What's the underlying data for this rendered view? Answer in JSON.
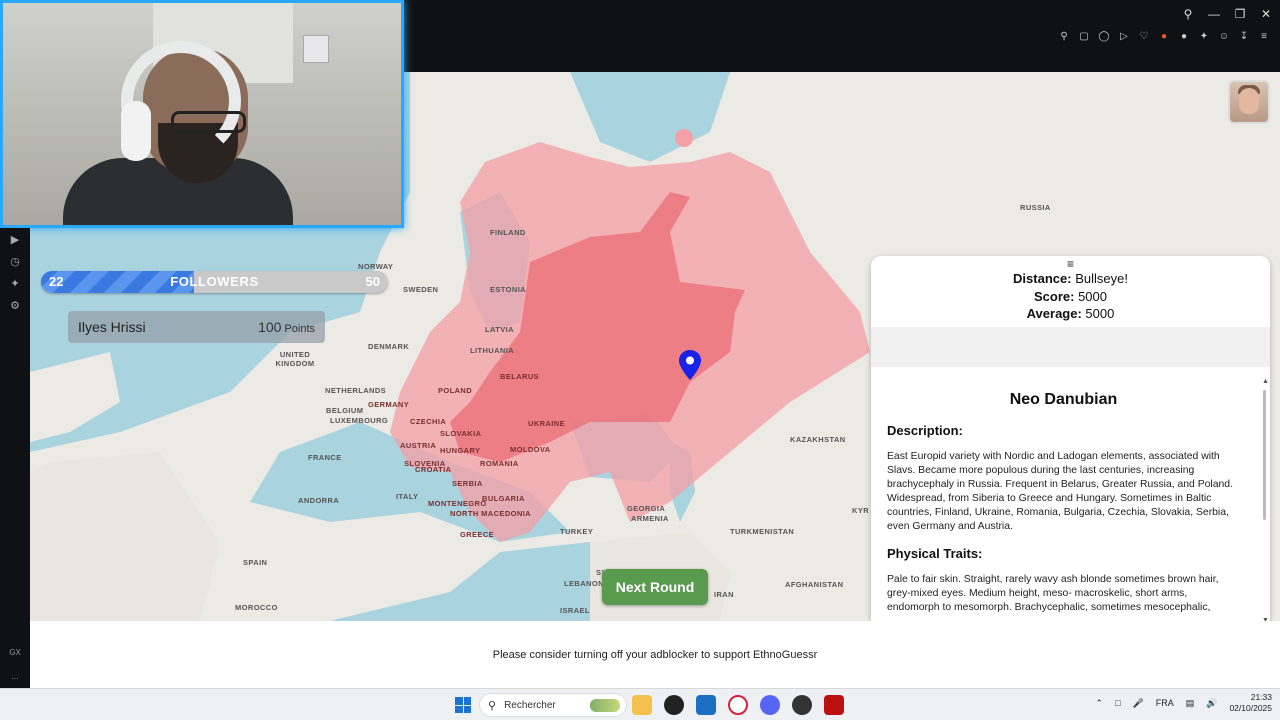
{
  "map": {
    "labels": {
      "russia": "RUSSIA",
      "finland": "FINLAND",
      "norway": "NORWAY",
      "sweden": "SWEDEN",
      "estonia": "ESTONIA",
      "latvia": "LATVIA",
      "lithuania": "LITHUANIA",
      "denmark": "DENMARK",
      "uk": "UNITED KINGDOM",
      "belarus": "BELARUS",
      "netherlands": "NETHERLANDS",
      "poland": "POLAND",
      "belgium": "BELGIUM",
      "luxembourg": "LUXEMBOURG",
      "germany": "GERMANY",
      "czechia": "CZECHIA",
      "ukraine": "UKRAINE",
      "kazakhstan": "KAZAKHSTAN",
      "slovakia": "SLOVAKIA",
      "austria": "AUSTRIA",
      "moldova": "MOLDOVA",
      "france": "FRANCE",
      "hungary": "HUNGARY",
      "slovenia": "SLOVENIA",
      "croatia": "CROATIA",
      "romania": "ROMANIA",
      "serbia": "SERBIA",
      "italy": "ITALY",
      "andorra": "ANDORRA",
      "bulgaria": "BULGARIA",
      "montenegro": "MONTENEGRO",
      "north_macedonia": "NORTH MACEDONIA",
      "georgia": "GEORGIA",
      "armenia": "ARMENIA",
      "spain": "SPAIN",
      "greece": "GREECE",
      "turkey": "TURKEY",
      "turkmenistan": "TURKMENISTAN",
      "syria": "SYRIA",
      "lebanon": "LEBANON",
      "afghanistan": "AFGHANISTAN",
      "israel": "ISRAEL",
      "iran": "IRAN",
      "morocco": "MOROCCO",
      "kyrgyz": "KYR"
    }
  },
  "followers": {
    "label": "FOLLOWERS",
    "current": "22",
    "goal": "50",
    "progress": 0.44
  },
  "player": {
    "name": "Ilyes Hrissi",
    "points": "100",
    "points_label": "Points"
  },
  "result": {
    "menu_glyph": "≡",
    "distance_label": "Distance:",
    "distance_value": "Bullseye!",
    "score_label": "Score:",
    "score_value": "5000",
    "average_label": "Average:",
    "average_value": "5000",
    "title": "Neo Danubian",
    "description_heading": "Description:",
    "description": "East Europid variety with Nordic and Ladogan elements, associated with Slavs. Became more populous during the last centuries, increasing brachycephaly in Russia. Frequent in Belarus, Greater Russia, and Poland. Widespread, from Siberia to Greece and Hungary. Sometimes in Baltic countries, Finland, Ukraine, Romania, Bulgaria, Czechia, Slovakia, Serbia, even Germany and Austria.",
    "traits_heading": "Physical Traits:",
    "traits": "Pale to fair skin. Straight, rarely wavy ash blonde sometimes brown hair, grey-mixed eyes. Medium height, meso- macroskelic, short arms, endomorph to mesomorph. Brachycephalic, sometimes mesocephalic,"
  },
  "next_round": "Next Round",
  "footer": "Please consider turning off your adblocker to support EthnoGuessr",
  "taskbar": {
    "search_placeholder": "Rechercher",
    "language": "FRA",
    "time": "21:33",
    "date": "02/10/2025"
  },
  "sidebar": {
    "gx_label": "GX",
    "more_label": "..."
  },
  "colors": {
    "accent_blue": "#2aa8ff",
    "region_light": "#f4a0a6",
    "region_dark": "#ec6b73",
    "button_green": "#5a9a4f",
    "pin": "#1a22e6"
  }
}
